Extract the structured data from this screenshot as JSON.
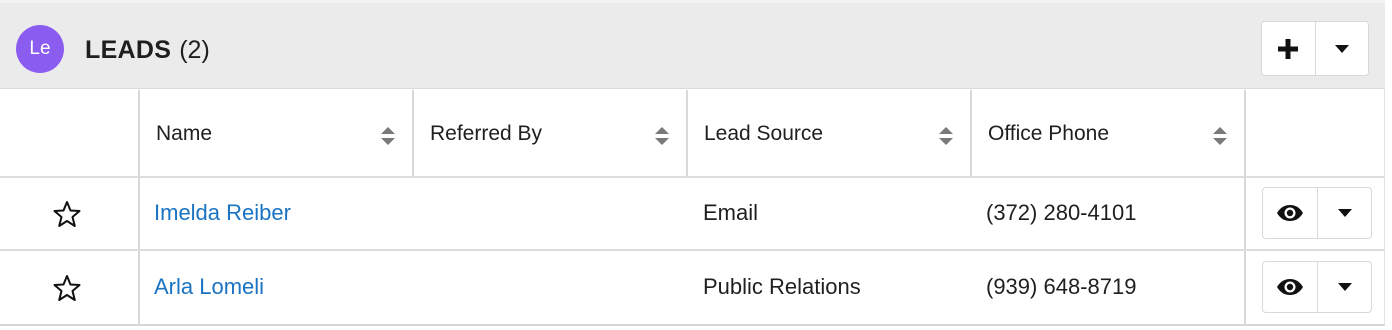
{
  "module": {
    "avatar_text": "Le",
    "avatar_color": "#8a5cf0",
    "title": "LEADS",
    "count": "(2)",
    "add_icon": "plus-icon",
    "menu_icon": "caret-down-icon"
  },
  "table": {
    "columns": [
      {
        "label": "Name",
        "sortable": true
      },
      {
        "label": "Referred By",
        "sortable": true
      },
      {
        "label": "Lead Source",
        "sortable": true
      },
      {
        "label": "Office Phone",
        "sortable": true
      }
    ],
    "rows": [
      {
        "favorite": false,
        "name": "Imelda Reiber",
        "referred_by": "",
        "lead_source": "Email",
        "office_phone": "(372) 280-4101"
      },
      {
        "favorite": false,
        "name": "Arla Lomeli",
        "referred_by": "",
        "lead_source": "Public Relations",
        "office_phone": "(939) 648-8719"
      }
    ],
    "row_action_icon": "eye-icon",
    "row_menu_icon": "caret-down-icon"
  },
  "colors": {
    "link": "#1a73c3",
    "header_bg": "#ebebeb"
  }
}
